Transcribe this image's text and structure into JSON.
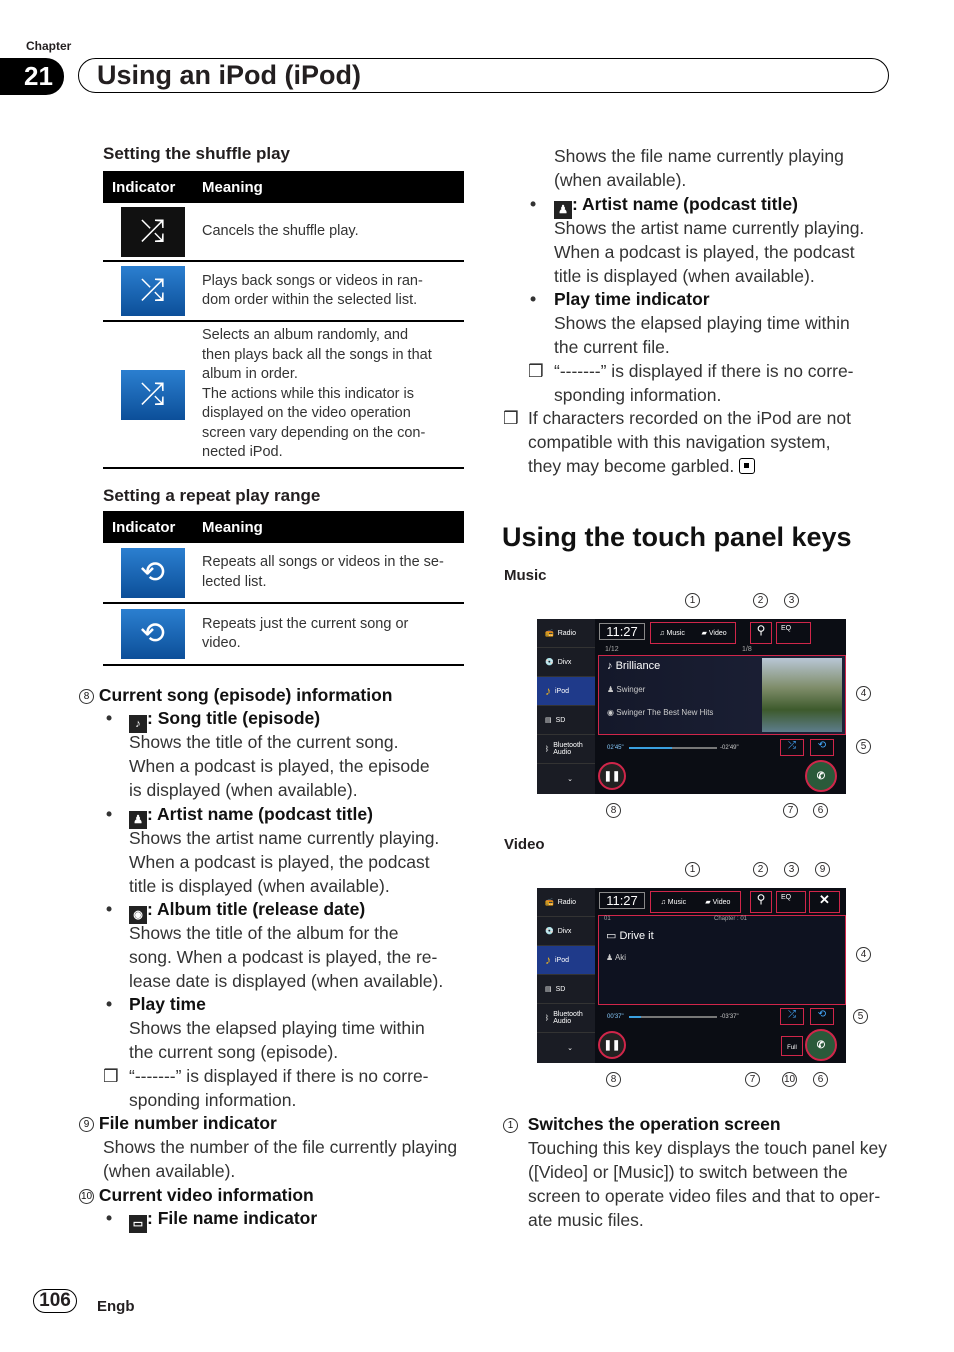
{
  "header": {
    "chapter_label": "Chapter",
    "chapter_number": "21",
    "title": "Using an iPod (iPod)"
  },
  "shuffle": {
    "heading": "Setting the shuffle play",
    "col1": "Indicator",
    "col2": "Meaning",
    "rows": [
      {
        "icon": "shuffle-off-icon",
        "text": "Cancels the shuffle play."
      },
      {
        "icon": "shuffle-songs-icon",
        "lines": [
          "Plays back songs or videos in ran-",
          "dom order within the selected list."
        ]
      },
      {
        "icon": "shuffle-album-icon",
        "lines": [
          "Selects an album randomly, and",
          "then plays back all the songs in that",
          "album in order.",
          "The actions while this indicator is",
          "displayed on the video operation",
          "screen vary depending on the con-",
          "nected iPod."
        ]
      }
    ]
  },
  "repeat": {
    "heading": "Setting a repeat play range",
    "col1": "Indicator",
    "col2": "Meaning",
    "rows": [
      {
        "icon": "repeat-all-icon",
        "lines": [
          "Repeats all songs or videos in the se-",
          "lected list."
        ]
      },
      {
        "icon": "repeat-one-icon",
        "lines": [
          "Repeats just the current song or",
          "video."
        ]
      }
    ]
  },
  "left": {
    "item8": {
      "num": "8",
      "title": "Current song (episode) information"
    },
    "song_title": {
      "label": "Song title (episode)",
      "lines": [
        "Shows the title of the current song.",
        "When a podcast is played, the episode",
        "is displayed (when available)."
      ]
    },
    "artist": {
      "label": "Artist name (podcast title)",
      "lines": [
        "Shows the artist name currently playing.",
        "When a podcast is played, the podcast",
        "title is displayed (when available)."
      ]
    },
    "album": {
      "label": "Album title (release date)",
      "lines": [
        "Shows the title of the album for the",
        "song. When a podcast is played, the re-",
        "lease date is displayed (when available)."
      ]
    },
    "playtime": {
      "label": "Play time",
      "lines": [
        "Shows the elapsed playing time within",
        "the current song (episode)."
      ]
    },
    "note": [
      "“-------” is displayed if there is no corre-",
      "sponding information."
    ],
    "item9": {
      "num": "9",
      "title": "File number indicator",
      "lines": [
        "Shows the number of the file currently playing",
        "(when available)."
      ]
    },
    "item10": {
      "num": "10",
      "title": "Current video information"
    },
    "filename": {
      "label": "File name indicator"
    }
  },
  "right": {
    "intro": [
      "Shows the file name currently playing",
      "(when available)."
    ],
    "artist": {
      "label": "Artist name (podcast title)",
      "lines": [
        "Shows the artist name currently playing.",
        "When a podcast is played, the podcast",
        "title is displayed (when available)."
      ]
    },
    "playtime": {
      "label": "Play time indicator",
      "lines": [
        "Shows the elapsed playing time within",
        "the current file."
      ]
    },
    "note1": [
      "“-------” is displayed if there is no corre-",
      "sponding information."
    ],
    "note2": [
      "If characters recorded on the iPod are not",
      "compatible with this navigation system,",
      "they may become garbled."
    ],
    "section_title": "Using the touch panel keys",
    "music_label": "Music",
    "video_label": "Video",
    "item1": {
      "num": "1",
      "title": "Switches the operation screen",
      "lines": [
        "Touching this key displays the touch panel key",
        "([Video] or [Music]) to switch between the",
        "screen to operate video files and that to oper-",
        "ate music files."
      ]
    }
  },
  "screen": {
    "sources": [
      "Radio",
      "Divx",
      "iPod",
      "SD",
      "Bluetooth Audio"
    ],
    "clock": "11:27",
    "tab_music": "Music",
    "tab_video": "Video",
    "eq": "EQ",
    "music": {
      "file_no": "1/12",
      "track_no": "1/8",
      "song": "Brilliance",
      "artist": "Swinger",
      "album": "Swinger The Best New Hits",
      "elapsed": "02'45\"",
      "remaining": "-02'49\"",
      "progress": 0.49
    },
    "video": {
      "file_no": "01",
      "chapter": "Chapter : 01",
      "title": "Drive it",
      "artist": "Aki",
      "elapsed": "00'37\"",
      "remaining": "-03'37\"",
      "progress": 0.14,
      "full": "Full"
    },
    "accent": "#d0264a"
  },
  "footer": {
    "page": "106",
    "lang": "Engb"
  }
}
